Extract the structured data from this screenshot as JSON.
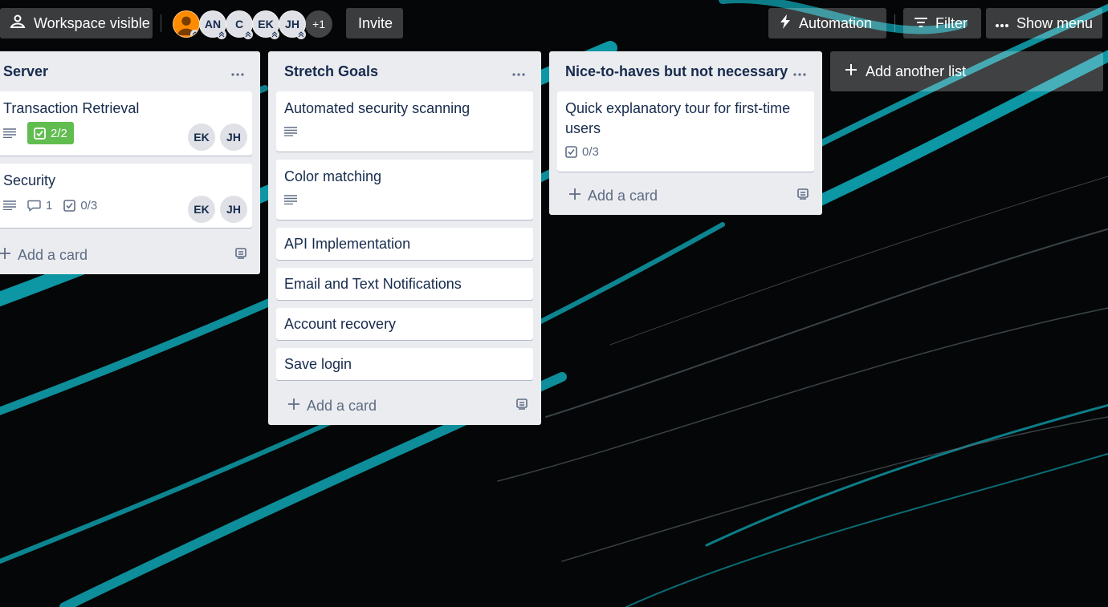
{
  "theme": {
    "accent": "#00b3c2",
    "background": "#050607",
    "list_bg": "#ebecf0",
    "done_badge": "#61bd4f"
  },
  "header": {
    "visibility_label": "Workspace visible",
    "visibility_icon": "workspace-visible-icon",
    "members": [
      {
        "initials": "",
        "kind": "photo"
      },
      {
        "initials": "AN"
      },
      {
        "initials": "C"
      },
      {
        "initials": "EK"
      },
      {
        "initials": "JH"
      }
    ],
    "more_members": "+1",
    "invite_label": "Invite",
    "automation_label": "Automation",
    "filter_label": "Filter",
    "show_menu_label": "Show menu"
  },
  "lists": [
    {
      "title": "Server",
      "add_card_label": "Add a card",
      "cards": [
        {
          "title": "Transaction Retrieval",
          "checklist": "2/2",
          "members": [
            "EK",
            "JH"
          ]
        },
        {
          "title": "Security",
          "comments": "1",
          "checklist": "0/3",
          "members": [
            "EK",
            "JH"
          ]
        }
      ]
    },
    {
      "title": "Stretch Goals",
      "add_card_label": "Add a card",
      "cards": [
        {
          "title": "Automated security scanning"
        },
        {
          "title": "Color matching"
        },
        {
          "title": "API Implementation"
        },
        {
          "title": "Email and Text Notifications"
        },
        {
          "title": "Account recovery"
        },
        {
          "title": "Save login"
        }
      ]
    },
    {
      "title": "Nice-to-haves but not necessary",
      "add_card_label": "Add a card",
      "cards": [
        {
          "title": "Quick explanatory tour for first-time users",
          "checklist": "0/3"
        }
      ]
    }
  ],
  "add_list_label": "Add another list"
}
